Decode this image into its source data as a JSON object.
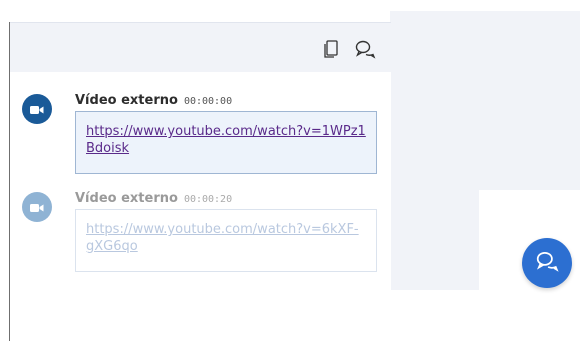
{
  "header": {
    "copy_icon": "copy-icon",
    "chat_icon": "chat-bubbles-icon"
  },
  "messages": [
    {
      "title": "Vídeo externo",
      "time": "00:00:00",
      "url": "https://www.youtube.com/watch?v=1WPz1Bdoisk",
      "icon": "video-camera-icon",
      "state": "active"
    },
    {
      "title": "Vídeo externo",
      "time": "00:00:20",
      "url": "https://www.youtube.com/watch?v=6kXF-gXG6qo",
      "icon": "video-camera-icon",
      "state": "dimmed"
    }
  ],
  "fab": {
    "icon": "chat-bubbles-icon"
  },
  "colors": {
    "primary": "#1a5a98",
    "fab": "#2c6fd1",
    "panel_bg": "#f1f3f8",
    "link_active": "#5a2a8a",
    "link_dim": "#b9c8df"
  }
}
